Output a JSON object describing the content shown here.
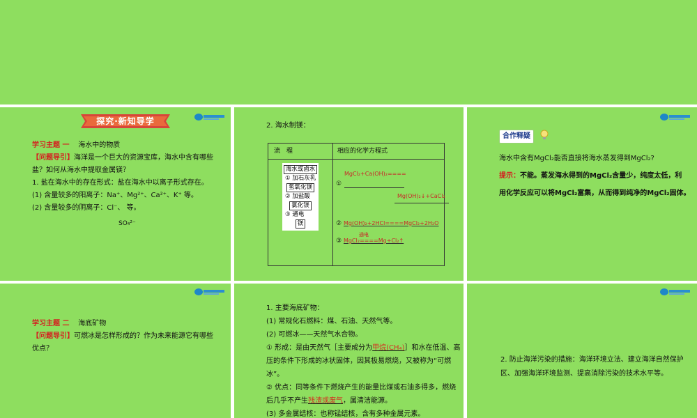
{
  "slide_1": {
    "banner_title": "探究·新知导学",
    "topic_label": "学习主题 一",
    "topic_title": "海水中的物质",
    "guide_label": "【问题导引】",
    "guide_text_1": "海洋是一个巨大的资源宝库，海水中含有哪些",
    "guide_text_2": "盐？如何从海水中提取金属镁？",
    "item_1": "1. 盐在海水中的存在形式：盐在海水中以离子形式存在。",
    "item_2": "(1) 含量较多的阳离子：Na⁺、Mg²⁺、Ca²⁺、K⁺ 等。",
    "item_3": "(2) 含量较多的阴离子：Cl⁻、   等。",
    "sulfate": "SO₄²⁻"
  },
  "slide_2": {
    "heading": "2. 海水制镁：",
    "col_process": "流　程",
    "col_equation": "相应的化学方程式",
    "flow": {
      "start": "海水或卤水",
      "step_1": "① 加石灰乳",
      "product_1": "氢氧化镁",
      "step_2": "② 加盐酸",
      "product_2": "氯化镁",
      "step_3": "③ 通电",
      "product_3": "镁"
    },
    "eq1_num": "①",
    "eq1_part1": "MgCl₂+Ca(OH)₂====",
    "eq1_part2": "Mg(OH)₂↓+CaCl₂",
    "eq2_num": "②",
    "eq2": "Mg(OH)₂+2HCl====MgCl₂+2H₂O",
    "eq3_num": "③",
    "eq3_condition": "通电",
    "eq3": "MgCl₂====Mg+Cl₂↑"
  },
  "slide_3": {
    "badge": "合作释疑",
    "question": "海水中含有MgCl₂能否直接将海水蒸发得到MgCl₂?",
    "hint_label": "提示：",
    "hint_1": "不能。蒸发海水得到的MgCl₂含量少，纯度太低，利",
    "hint_2": "用化学反应可以将MgCl₂富集，从而得到纯净的MgCl₂固体。"
  },
  "slide_4": {
    "topic_label": "学习主题 二",
    "topic_title": "海底矿物",
    "guide_label": "【问题导引】",
    "guide_text_1": "可燃冰是怎样形成的？作为未来能源它有哪些",
    "guide_text_2": "优点？"
  },
  "slide_5": {
    "line_1": "1. 主要海底矿物：",
    "line_2": "(1) 常规化石燃料：煤、石油、天然气等。",
    "line_3": "(2) 可燃冰——天然气水合物。",
    "line_4a": "① 形成：是由天然气［主要成分为",
    "answer_1": "甲烷(CH₄)",
    "line_4b": "］和水在低温、高",
    "line_5": "压的条件下形成的冰状固体，因其极易燃烧，又被称为“可燃",
    "line_6": "冰”。",
    "line_7": "② 优点：同等条件下燃烧产生的能量比煤或石油多得多，燃烧",
    "line_8a": "后几乎不产生",
    "answer_2": "残渣或废气",
    "line_8b": "，属清洁能源。",
    "line_9": "(3) 多金属结核：也称锰结核，含有多种金属元素。"
  },
  "slide_6": {
    "line_1": "2. 防止海洋污染的措施：海洋环境立法、建立海洋自然保护",
    "line_2": "区、加强海洋环境监测、提高消除污染的技术水平等。"
  },
  "colors": {
    "background": "#8ede5f",
    "accent_red": "#d42020",
    "divider": "#ffffff"
  }
}
